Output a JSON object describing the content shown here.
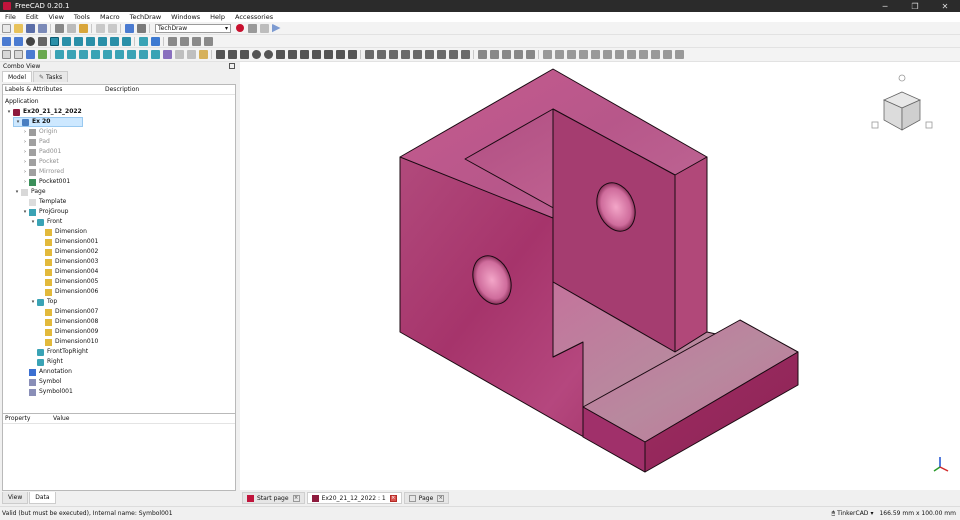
{
  "window": {
    "title": "FreeCAD 0.20.1"
  },
  "menu": [
    "File",
    "Edit",
    "View",
    "Tools",
    "Macro",
    "TechDraw",
    "Windows",
    "Help",
    "Accessories"
  ],
  "workbench": {
    "selected": "TechDraw"
  },
  "combo": {
    "title": "Combo View",
    "tabs": [
      "Model",
      "Tasks"
    ],
    "columns": [
      "Labels & Attributes",
      "Description"
    ],
    "root_label": "Application",
    "tree": [
      {
        "label": "Ex20_21_12_2022",
        "arrow": "▾",
        "icon": "document-icon",
        "color": "#8e1b3e"
      },
      {
        "label": "Ex 20",
        "arrow": "▾",
        "icon": "body-icon",
        "color": "#4a7fc1"
      },
      {
        "label": "Origin",
        "arrow": "›",
        "icon": "origin-icon",
        "color": "#9c9c9c"
      },
      {
        "label": "Pad",
        "arrow": "›",
        "icon": "pad-icon",
        "color": "#a0a0a0"
      },
      {
        "label": "Pad001",
        "arrow": "›",
        "icon": "pad-icon",
        "color": "#a0a0a0"
      },
      {
        "label": "Pocket",
        "arrow": "›",
        "icon": "pocket-icon",
        "color": "#a0a0a0"
      },
      {
        "label": "Mirrored",
        "arrow": "›",
        "icon": "mirror-icon",
        "color": "#a0a0a0"
      },
      {
        "label": "Pocket001",
        "arrow": "›",
        "icon": "pocket-icon",
        "color": "#3b8f5a"
      },
      {
        "label": "Page",
        "arrow": "▾",
        "icon": "page-icon",
        "color": "#d8d8d8"
      },
      {
        "label": "Template",
        "arrow": "",
        "icon": "template-icon",
        "color": "#dcdcdc"
      },
      {
        "label": "ProjGroup",
        "arrow": "▾",
        "icon": "projgroup-icon",
        "color": "#3aa3b5"
      },
      {
        "label": "Front",
        "arrow": "▾",
        "icon": "view-icon",
        "color": "#3aa3b5"
      },
      {
        "label": "Dimension",
        "arrow": "",
        "icon": "dimension-h-icon",
        "color": "#e2b93b"
      },
      {
        "label": "Dimension001",
        "arrow": "",
        "icon": "dimension-h-icon",
        "color": "#e2b93b"
      },
      {
        "label": "Dimension002",
        "arrow": "",
        "icon": "dimension-v-icon",
        "color": "#e2b93b"
      },
      {
        "label": "Dimension003",
        "arrow": "",
        "icon": "dimension-h-icon",
        "color": "#e2b93b"
      },
      {
        "label": "Dimension004",
        "arrow": "",
        "icon": "dimension-h-icon",
        "color": "#e2b93b"
      },
      {
        "label": "Dimension005",
        "arrow": "",
        "icon": "dimension-h-icon",
        "color": "#e2b93b"
      },
      {
        "label": "Dimension006",
        "arrow": "",
        "icon": "dimension-v-icon",
        "color": "#e2b93b"
      },
      {
        "label": "Top",
        "arrow": "▾",
        "icon": "view-icon",
        "color": "#3aa3b5"
      },
      {
        "label": "Dimension007",
        "arrow": "",
        "icon": "dimension-h-icon",
        "color": "#e2b93b"
      },
      {
        "label": "Dimension008",
        "arrow": "",
        "icon": "dimension-v-icon",
        "color": "#e2b93b"
      },
      {
        "label": "Dimension009",
        "arrow": "",
        "icon": "dimension-h-icon",
        "color": "#e2b93b"
      },
      {
        "label": "Dimension010",
        "arrow": "",
        "icon": "dimension-h-icon",
        "color": "#e2b93b"
      },
      {
        "label": "FrontTopRight",
        "arrow": "",
        "icon": "view-icon",
        "color": "#3aa3b5"
      },
      {
        "label": "Right",
        "arrow": "",
        "icon": "view-icon",
        "color": "#3aa3b5"
      },
      {
        "label": "Annotation",
        "arrow": "",
        "icon": "annotation-icon",
        "color": "#3b6fd1"
      },
      {
        "label": "Symbol",
        "arrow": "",
        "icon": "symbol-icon",
        "color": "#8a8fb8"
      },
      {
        "label": "Symbol001",
        "arrow": "",
        "icon": "symbol-icon",
        "color": "#8a8fb8"
      }
    ]
  },
  "properties": {
    "columns": [
      "Property",
      "Value"
    ],
    "tabs": [
      "View",
      "Data"
    ]
  },
  "doc_tabs": [
    {
      "label": "Start page",
      "icon": "start-icon"
    },
    {
      "label": "Ex20_21_12_2022 : 1",
      "icon": "document-icon"
    },
    {
      "label": "Page",
      "icon": "page-icon"
    }
  ],
  "status": {
    "message": "Valid (but must be executed), Internal name: Symbol001",
    "navigation": "TinkerCAD",
    "dimensions": "166.59 mm x 100.00 mm"
  },
  "colors": {
    "model": "#b03a72",
    "edge": "#1a0a12",
    "selection": "#cde8ff"
  }
}
